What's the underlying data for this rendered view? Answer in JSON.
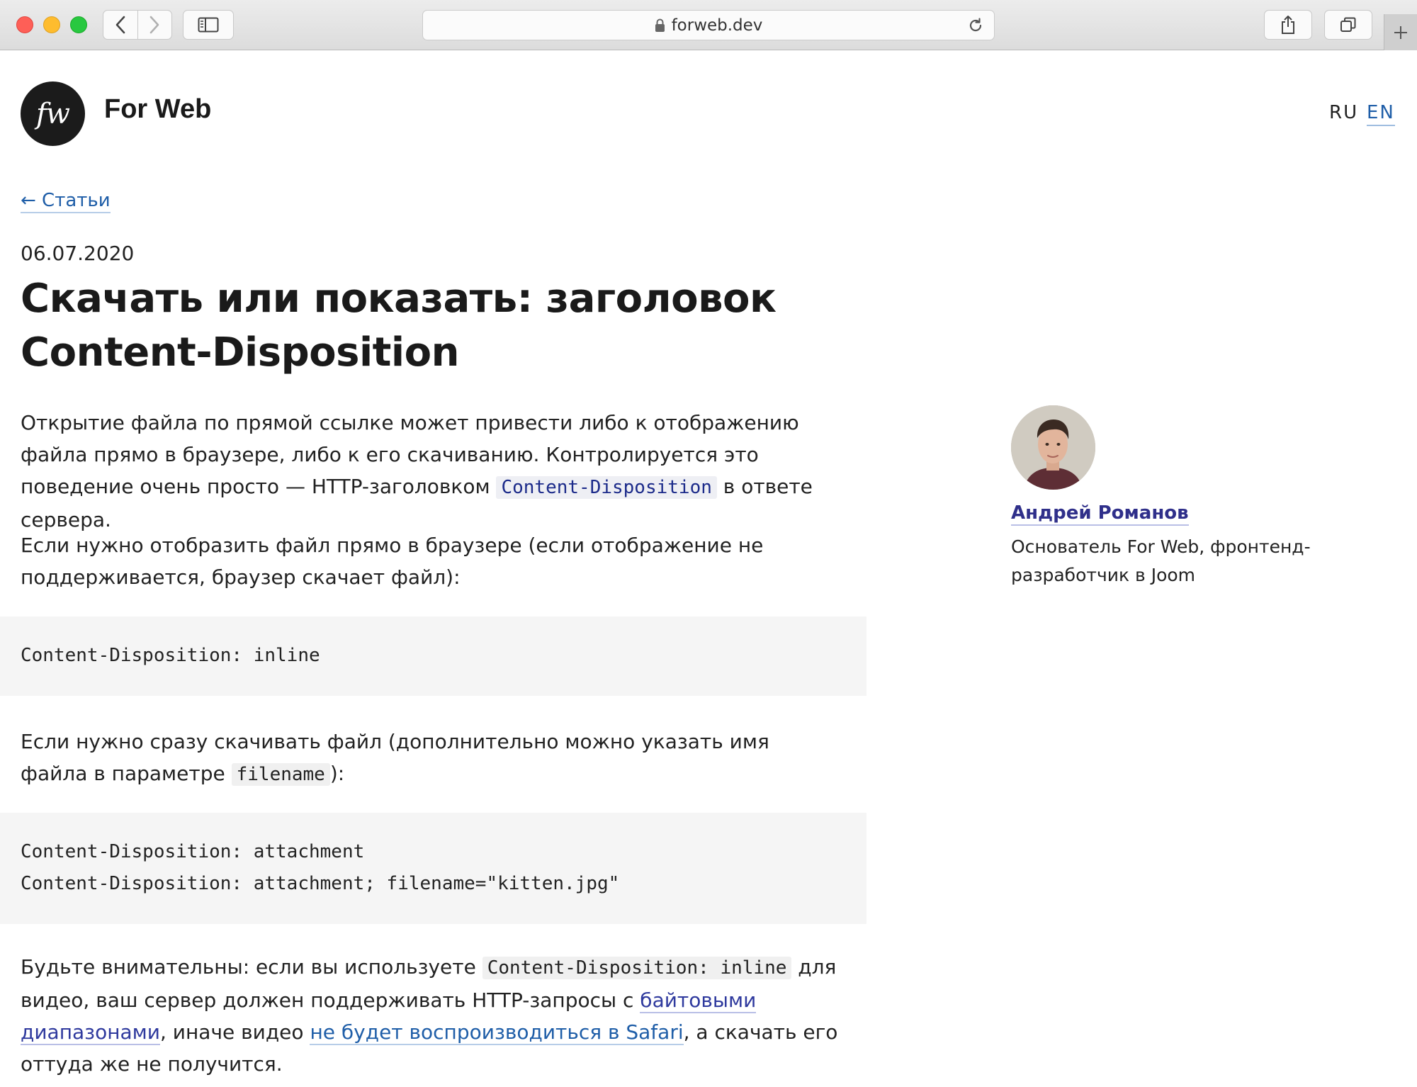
{
  "browser": {
    "url": "forweb.dev"
  },
  "site": {
    "logo_text": "fw",
    "name": "For Web",
    "lang_ru": "RU",
    "lang_en": "EN"
  },
  "nav": {
    "back_label": "← Статьи"
  },
  "article": {
    "date": "06.07.2020",
    "title": "Скачать или показать: заголовок Content-Disposition",
    "p1": {
      "text_before": "Открытие файла по прямой ссылке может привести либо к отображению файла прямо в браузере, либо к его скачиванию. Контролируется это поведение очень просто — HTTP-заголовком ",
      "code": "Content-Disposition",
      "text_after": " в ответе сервера."
    },
    "p2": {
      "text": "Если нужно отобразить файл прямо в браузере (если отображение не поддерживается, браузер скачает файл):"
    },
    "code1": {
      "lines": [
        "Content-Disposition: inline"
      ]
    },
    "p3": {
      "text_before": "Если нужно сразу скачивать файл (дополнительно можно указать имя файла в параметре ",
      "code": "filename",
      "text_after": "):"
    },
    "code2": {
      "lines": [
        "Content-Disposition: attachment",
        "Content-Disposition: attachment; filename=\"kitten.jpg\""
      ]
    },
    "p4": {
      "text_before": "Будьте внимательны: если вы используете ",
      "code": "Content-Disposition: inline",
      "text_mid1": " для видео, ваш сервер должен поддерживать HTTP-запросы с ",
      "link1": "байтовыми диапазонами",
      "text_mid2": ", иначе видео ",
      "link2": "не будет воспроизводиться в Safari",
      "text_after": ", а скачать его оттуда же не получится."
    }
  },
  "author": {
    "name": "Андрей Романов",
    "bio": "Основатель For Web, фронтенд-разработчик в Joom"
  },
  "colors": {
    "link_blue": "#1f5ea8",
    "link_purple": "#2f2f8a",
    "code_bg": "#f5f5f5"
  }
}
